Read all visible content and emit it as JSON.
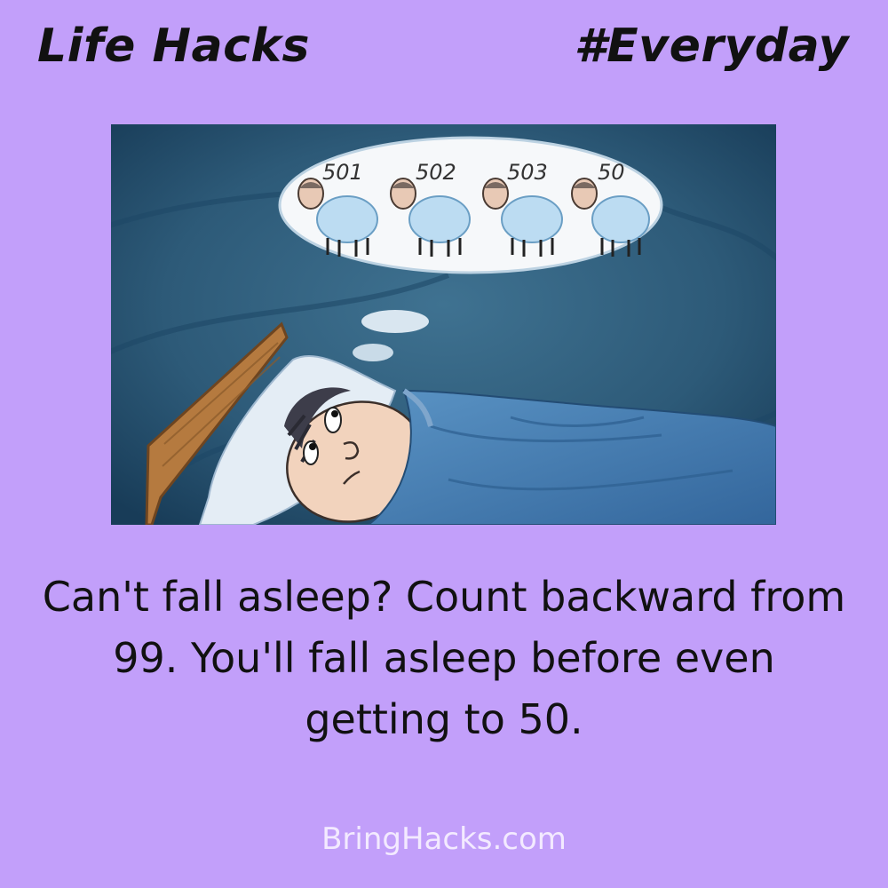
{
  "header": {
    "left_title": "Life Hacks",
    "right_title": "#Everyday"
  },
  "illustration": {
    "icon": "man-counting-sheep-in-bed-illustration",
    "sheep_numbers": [
      "501",
      "502",
      "503",
      "50"
    ]
  },
  "caption": {
    "text": "Can't fall asleep? Count backward from 99. You'll fall asleep before even getting to 50."
  },
  "footer": {
    "site": "BringHacks.com"
  },
  "colors": {
    "background": "#c29ffa",
    "night_sky": "#2d5a78",
    "blanket": "#4f86b8",
    "footer_text": "#f3eaff"
  }
}
